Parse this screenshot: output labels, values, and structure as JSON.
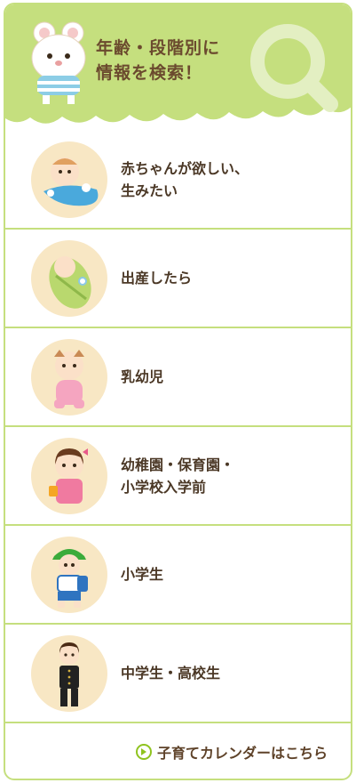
{
  "header": {
    "title": "年齢・段階別に\n情報を検索！"
  },
  "items": [
    {
      "label": "赤ちゃんが欲しい、\n生みたい",
      "icon": "baby-bath-icon"
    },
    {
      "label": "出産したら",
      "icon": "swaddled-baby-icon"
    },
    {
      "label": "乳幼児",
      "icon": "toddler-icon"
    },
    {
      "label": "幼稚園・保育園・\n小学校入学前",
      "icon": "preschool-girl-icon"
    },
    {
      "label": "小学生",
      "icon": "elementary-boy-icon"
    },
    {
      "label": "中学生・高校生",
      "icon": "student-uniform-icon"
    }
  ],
  "footer": {
    "link_label": "子育てカレンダーはこちら"
  },
  "colors": {
    "accent_green": "#c5df7e",
    "text_brown": "#4b3826",
    "circle_beige": "#f8e7c4"
  }
}
